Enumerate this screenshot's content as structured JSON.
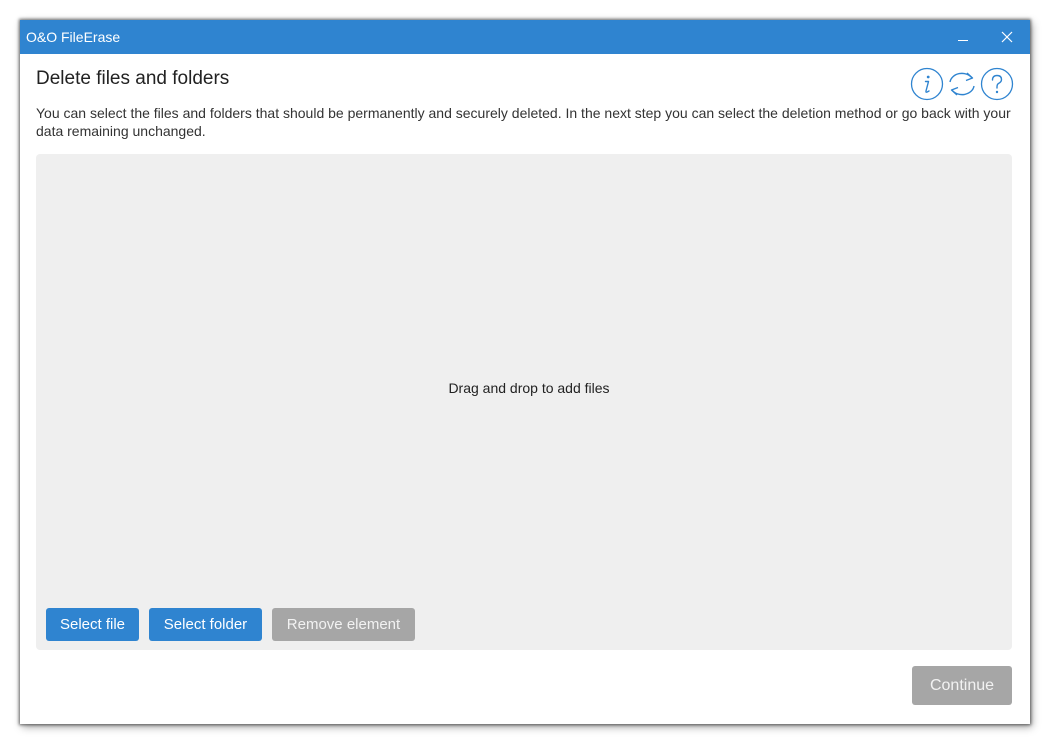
{
  "window": {
    "title": "O&O FileErase",
    "minimize_label": "Minimize",
    "close_label": "Close"
  },
  "header": {
    "title": "Delete files and folders",
    "description": "You can select the files and folders that should be permanently and securely deleted. In the next step you can select the deletion method or go back with your data remaining unchanged.",
    "icons": [
      "info-icon",
      "refresh-icon",
      "help-icon"
    ]
  },
  "dropzone": {
    "hint": "Drag and drop to add files"
  },
  "buttons": {
    "select_file": "Select file",
    "select_folder": "Select folder",
    "remove_element": "Remove element",
    "continue": "Continue"
  },
  "colors": {
    "accent": "#2f84d0",
    "disabled": "#a6a6a6",
    "dropzone_bg": "#efefef"
  }
}
